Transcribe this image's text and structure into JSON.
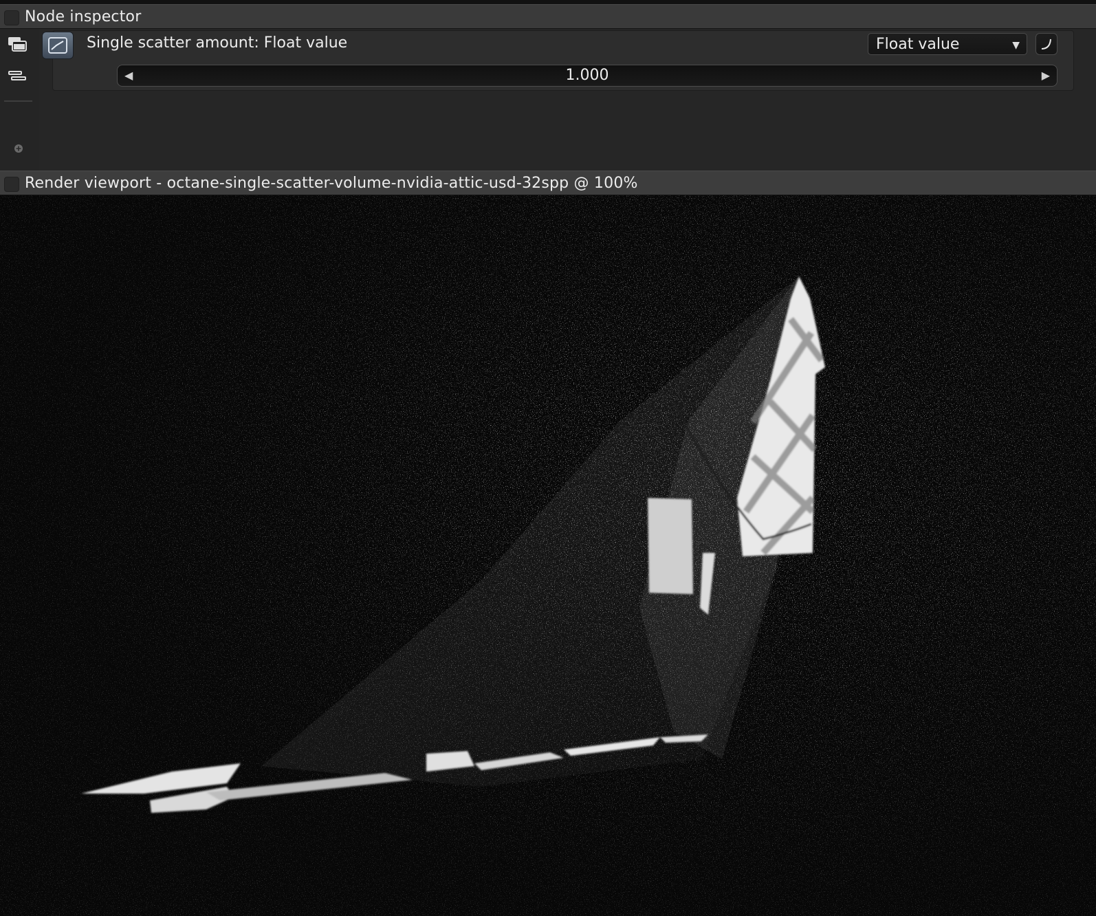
{
  "node_inspector": {
    "title": "Node inspector",
    "parameter_title": "Single scatter amount: Float value",
    "type_dropdown": "Float value",
    "slider_value": "1.000",
    "slider_left_arrow": "◀",
    "slider_right_arrow": "▶",
    "dropdown_caret": "▼",
    "icons": [
      "layers-icon",
      "list-collapse-icon",
      "add-node-icon",
      "float-node-icon",
      "curve-icon"
    ]
  },
  "render_viewport": {
    "title": "Render viewport - octane-single-scatter-volume-nvidia-attic-usd-32spp @ 100%",
    "image_description_icon": "render-image"
  },
  "colors": {
    "panel_header": "#3a3a3a",
    "panel_body": "#262626",
    "viewport_bg": "#070707",
    "text": "#ececec"
  }
}
